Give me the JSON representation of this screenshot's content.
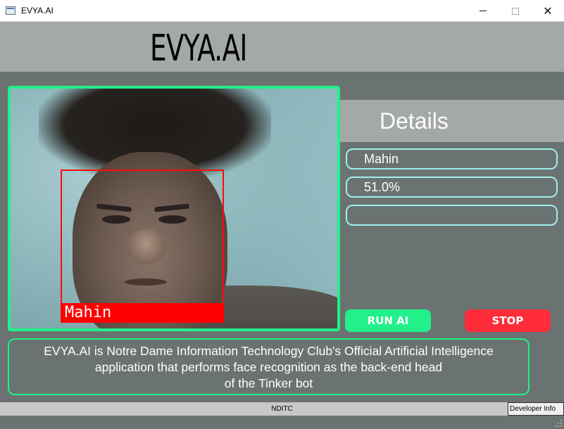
{
  "window": {
    "title": "EVYA.AI",
    "controls": {
      "minimize": "minimize",
      "maximize": "maximize",
      "close": "✕"
    }
  },
  "header": {
    "brand": "EVYA.AI"
  },
  "camera": {
    "detection": {
      "name": "Mahin"
    }
  },
  "details": {
    "title": "Details",
    "name_value": "Mahin",
    "confidence_value": "51.0%",
    "extra_value": ""
  },
  "actions": {
    "run_label": "RUN AI",
    "stop_label": "STOP"
  },
  "description": "EVYA.AI is Notre Dame Information Technology Club's Official Artificial Intelligence\napplication that performs  face recognition as the back-end head\nof the Tinker bot",
  "statusbar": {
    "center_text": "NDITC",
    "developer_button": "Developer Info"
  },
  "colors": {
    "accent_green": "#22f08a",
    "stop_red": "#ff2c3a",
    "field_border": "#9df0ee",
    "detection_red": "#ff0000",
    "panel_gray": "#a5a8a8",
    "background": "#6b7372"
  },
  "icons": {
    "app": "window-app-icon",
    "minimize": "minimize-icon",
    "maximize": "maximize-icon",
    "close": "close-icon",
    "resize": "resize-grip-icon"
  }
}
